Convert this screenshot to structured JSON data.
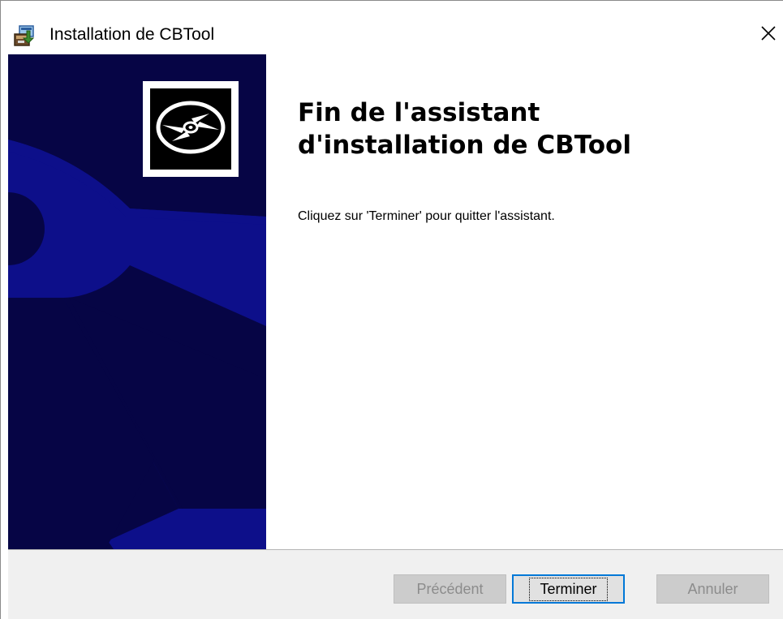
{
  "window": {
    "title": "Installation de CBTool"
  },
  "icons": {
    "app": "installer-package-icon",
    "close": "close-icon",
    "banner": "cd-disc-icon"
  },
  "colors": {
    "banner_dark": "#060545",
    "banner_blue": "#0d0f8a",
    "footer_bg": "#f0f0f0",
    "accent": "#0078d7"
  },
  "main": {
    "heading_line1": "Fin de l'assistant",
    "heading_line2": "d'installation de CBTool",
    "description": "Cliquez sur 'Terminer' pour quitter l'assistant."
  },
  "buttons": {
    "back_label": "Précédent",
    "finish_label": "Terminer",
    "cancel_label": "Annuler"
  }
}
